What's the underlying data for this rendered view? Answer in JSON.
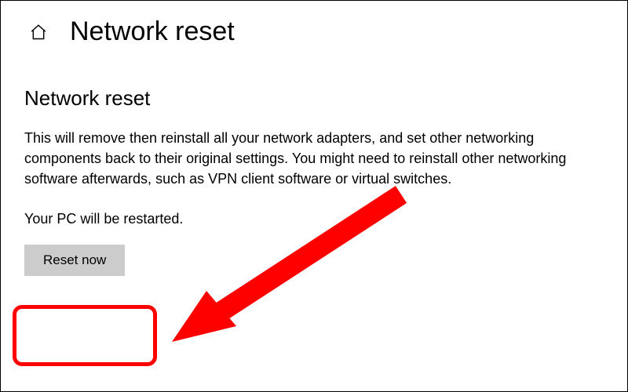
{
  "header": {
    "title": "Network reset"
  },
  "main": {
    "section_title": "Network reset",
    "description": "This will remove then reinstall all your network adapters, and set other networking components back to their original settings. You might need to reinstall other networking software afterwards, such as VPN client software or virtual switches.",
    "restart_note": "Your PC will be restarted.",
    "reset_button_label": "Reset now"
  }
}
